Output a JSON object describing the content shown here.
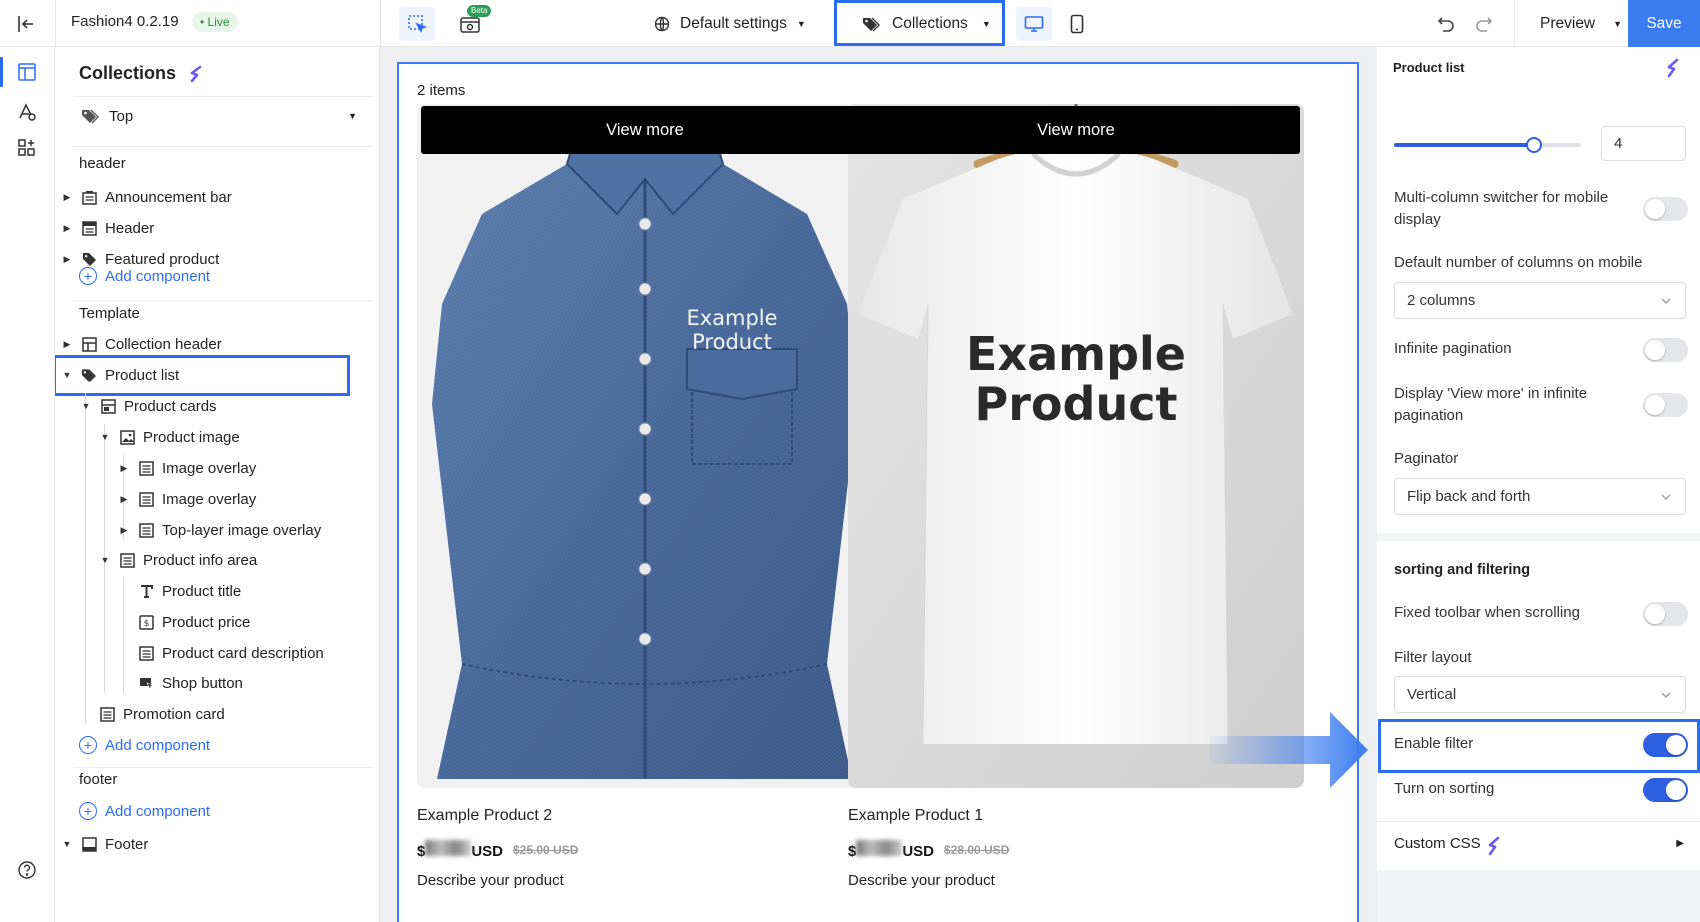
{
  "topbar": {
    "app_name": "Fashion4 0.2.19",
    "live_badge": "Live",
    "beta_badge": "Beta",
    "settings_label": "Default settings",
    "page_type_label": "Collections",
    "preview_label": "Preview",
    "save_label": "Save"
  },
  "tree": {
    "title": "Collections",
    "top_select": "Top",
    "header_section": "header",
    "header_items": [
      "Announcement bar",
      "Header",
      "Featured product"
    ],
    "add_component": "Add component",
    "template_section": "Template",
    "collection_header": "Collection header",
    "product_list": "Product list",
    "product_cards": "Product cards",
    "product_image": "Product image",
    "image_overlay_1": "Image overlay",
    "image_overlay_2": "Image overlay",
    "top_layer_overlay": "Top-layer image overlay",
    "product_info_area": "Product info area",
    "product_title": "Product title",
    "product_price": "Product price",
    "product_card_description": "Product card description",
    "shop_button": "Shop button",
    "promotion_card": "Promotion card",
    "footer_section": "footer",
    "footer_item": "Footer"
  },
  "canvas": {
    "items_count": "2 items",
    "products": [
      {
        "button": "View more",
        "image_text": "Example Product",
        "title": "Example Product 2",
        "currency": "USD",
        "old_price": "$25.00 USD",
        "description": "Describe your product"
      },
      {
        "button": "View more",
        "image_text": "Example Product",
        "title": "Example Product 1",
        "currency": "USD",
        "old_price": "$28.00 USD",
        "description": "Describe your product"
      }
    ]
  },
  "panel": {
    "title": "Product list",
    "columns_value": "4",
    "columns_slider_fraction": 0.75,
    "mobile_switcher_label": "Multi-column switcher for mobile display",
    "mobile_columns_label": "Default number of columns on mobile",
    "mobile_columns_value": "2 columns",
    "infinite_pagination_label": "Infinite pagination",
    "view_more_label": "Display 'View more' in infinite pagination",
    "paginator_label": "Paginator",
    "paginator_value": "Flip back and forth",
    "sorting_section": "sorting and filtering",
    "fixed_toolbar_label": "Fixed toolbar when scrolling",
    "filter_layout_label": "Filter layout",
    "filter_layout_value": "Vertical",
    "enable_filter_label": "Enable filter",
    "turn_on_sorting_label": "Turn on sorting",
    "custom_css_label": "Custom CSS"
  },
  "colors": {
    "accent": "#2a6df4",
    "save": "#3b7cf0",
    "toggle_on": "#2e5fe0",
    "live": "#2e8b3c"
  }
}
